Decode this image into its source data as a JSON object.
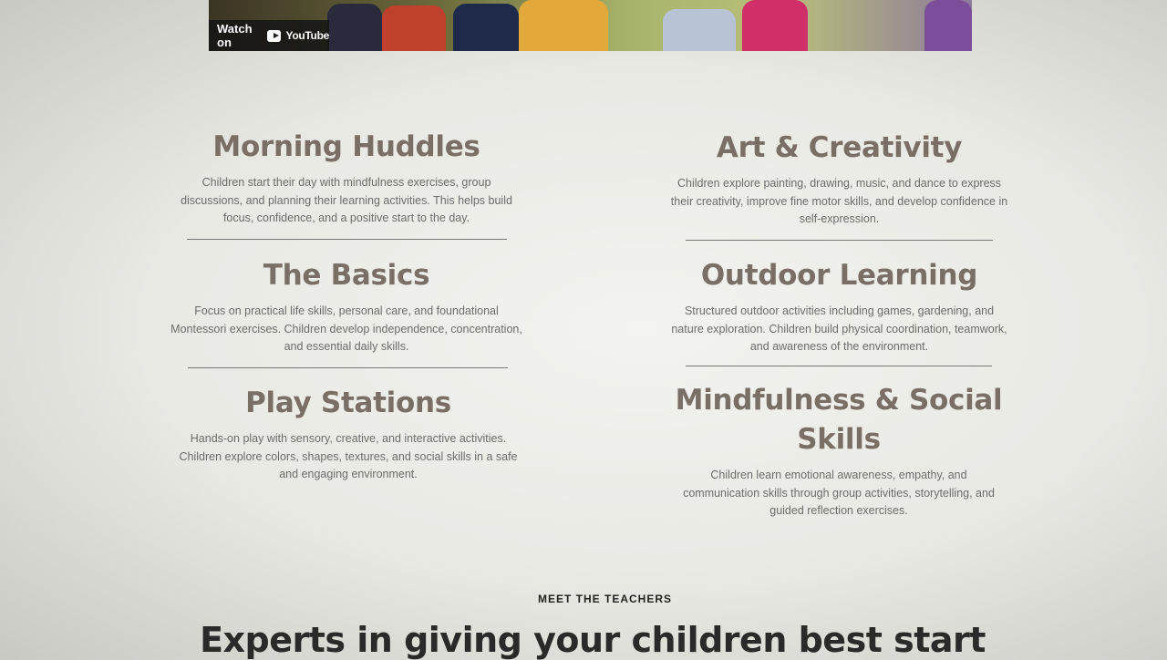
{
  "video": {
    "watch_on": "Watch on",
    "platform": "YouTube",
    "play_icon": "youtube-play-icon"
  },
  "activities": [
    {
      "title": "Morning Huddles",
      "description": "Children start their day with mindfulness exercises, group discussions, and planning their learning activities. This helps build focus, confidence, and a positive start to the day."
    },
    {
      "title": "Art & Creativity",
      "description": "Children explore painting, drawing, music, and dance to express their creativity, improve fine motor skills, and develop confidence in self-expression."
    },
    {
      "title": "The Basics",
      "description": "Focus on practical life skills, personal care, and foundational Montessori exercises. Children develop independence, concentration, and essential daily skills."
    },
    {
      "title": "Outdoor Learning",
      "description": "Structured outdoor activities including games, gardening, and nature exploration. Children build physical coordination, teamwork, and awareness of the environment."
    },
    {
      "title": "Play Stations",
      "description": "Hands-on play with sensory, creative, and interactive activities. Children explore colors, shapes, textures, and social skills in a safe and engaging environment."
    },
    {
      "title": "Mindfulness & Social Skills",
      "description": "Children learn emotional awareness, empathy, and communication skills through group activities, storytelling, and guided reflection exercises."
    }
  ],
  "teachers": {
    "eyebrow": "MEET THE TEACHERS",
    "headline": "Experts in giving your children best start"
  }
}
